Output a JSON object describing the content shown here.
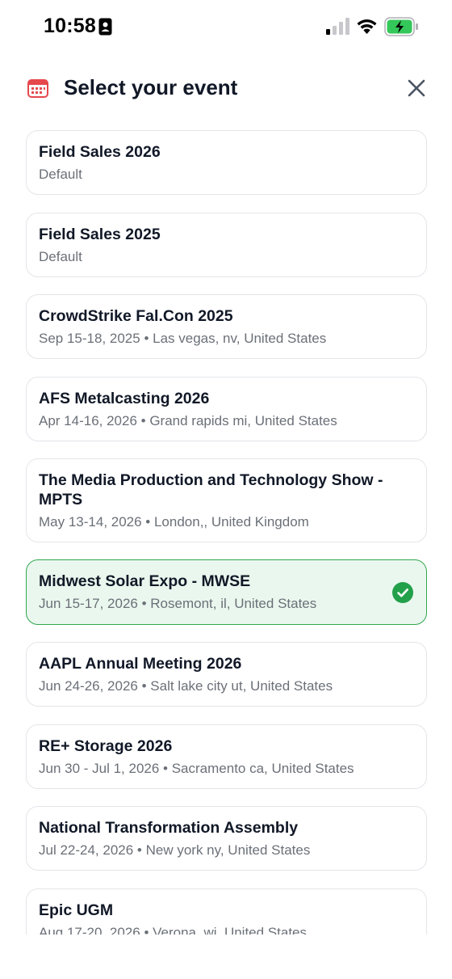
{
  "status_bar": {
    "time": "10:58",
    "icons": [
      "id-badge-icon",
      "signal-icon",
      "wifi-icon",
      "battery-charging-icon"
    ]
  },
  "header": {
    "title": "Select your event",
    "icon": "calendar-icon",
    "close_icon": "close-icon"
  },
  "colors": {
    "accent_red": "#e5484d",
    "selected_border": "#2fa84f",
    "selected_bg": "#eaf7ee",
    "check_green": "#22a04a"
  },
  "events": [
    {
      "name": "Field Sales 2026",
      "subtitle": "Default",
      "selected": false
    },
    {
      "name": "Field Sales 2025",
      "subtitle": "Default",
      "selected": false
    },
    {
      "name": "CrowdStrike Fal.Con 2025",
      "subtitle": "Sep 15-18, 2025 • Las vegas, nv, United States",
      "selected": false
    },
    {
      "name": "AFS Metalcasting 2026",
      "subtitle": "Apr 14-16, 2026 • Grand rapids mi, United States",
      "selected": false
    },
    {
      "name": "The Media Production and Technology Show - MPTS",
      "subtitle": "May 13-14, 2026 • London,, United Kingdom",
      "selected": false
    },
    {
      "name": "Midwest Solar Expo - MWSE",
      "subtitle": "Jun 15-17, 2026 • Rosemont, il, United States",
      "selected": true
    },
    {
      "name": "AAPL Annual Meeting 2026",
      "subtitle": "Jun 24-26, 2026 • Salt lake city ut, United States",
      "selected": false
    },
    {
      "name": "RE+ Storage 2026",
      "subtitle": "Jun 30 - Jul 1, 2026 • Sacramento ca, United States",
      "selected": false
    },
    {
      "name": "National Transformation Assembly",
      "subtitle": "Jul 22-24, 2026 • New york ny, United States",
      "selected": false
    },
    {
      "name": "Epic UGM",
      "subtitle": "Aug 17-20, 2026 • Verona, wi, United States",
      "selected": false
    }
  ]
}
